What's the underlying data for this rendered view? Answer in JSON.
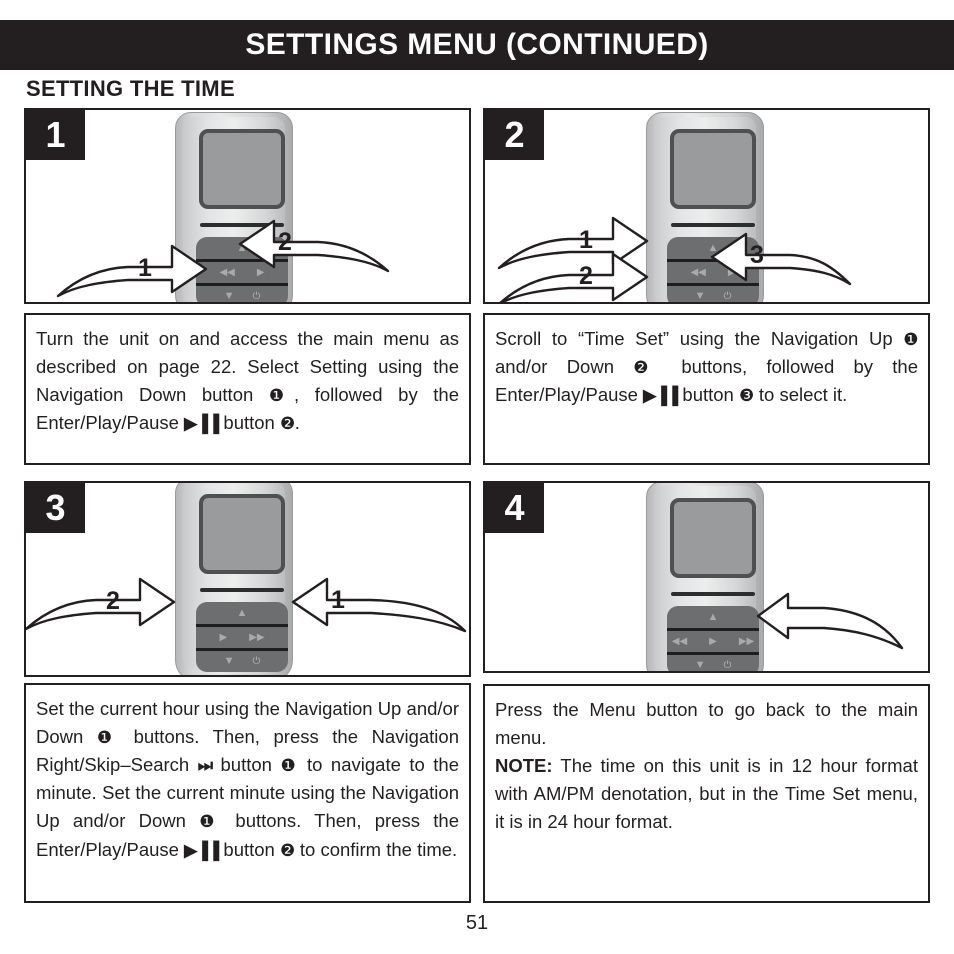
{
  "header": {
    "title": "SETTINGS MENU (CONTINUED)",
    "section_title": "SETTING THE TIME"
  },
  "colors": {
    "header_bg": "#231f20",
    "header_text": "#ffffff",
    "border": "#231f20",
    "device_body": "#d8d9da",
    "device_pad": "#6d6e70",
    "device_screen": "#9a9b9d"
  },
  "steps": [
    {
      "badge": "1",
      "callouts": [
        {
          "number": "1",
          "target": "navigation-down-button"
        },
        {
          "number": "2",
          "target": "enter-play-pause-button"
        }
      ],
      "text_parts": [
        {
          "t": "Turn the unit on and access the main menu as described on page 22. Select Setting using the Navigation Down button "
        },
        {
          "t": "❶",
          "style": "sym"
        },
        {
          "t": ", followed by the Enter/Play/Pause "
        },
        {
          "t": "▶▐▐",
          "style": "playpause"
        },
        {
          "t": " button "
        },
        {
          "t": "❷",
          "style": "sym"
        },
        {
          "t": "."
        }
      ]
    },
    {
      "badge": "2",
      "callouts": [
        {
          "number": "1",
          "target": "navigation-up-button"
        },
        {
          "number": "2",
          "target": "navigation-down-button"
        },
        {
          "number": "3",
          "target": "enter-play-pause-button"
        }
      ],
      "text_parts": [
        {
          "t": "Scroll to “Time Set” using the Navigation Up "
        },
        {
          "t": "❶",
          "style": "sym"
        },
        {
          "t": " and/or Down "
        },
        {
          "t": "❷",
          "style": "sym"
        },
        {
          "t": " buttons, followed by the Enter/Play/Pause "
        },
        {
          "t": "▶▐▐",
          "style": "playpause"
        },
        {
          "t": " button "
        },
        {
          "t": "❸",
          "style": "sym"
        },
        {
          "t": " to select it."
        }
      ]
    },
    {
      "badge": "3",
      "callouts": [
        {
          "number": "2",
          "target": "enter-play-pause-button"
        },
        {
          "number": "1",
          "target": "navigation-right-skip-search-button"
        }
      ],
      "text_parts": [
        {
          "t": "Set the current hour using the Navigation Up and/or Down "
        },
        {
          "t": "❶",
          "style": "sym"
        },
        {
          "t": " buttons. Then, press the Navigation Right/Skip–Search "
        },
        {
          "t": "⏭",
          "style": "playpause"
        },
        {
          "t": " button "
        },
        {
          "t": "❶",
          "style": "sym"
        },
        {
          "t": " to navigate to the minute. Set the current minute using the Navigation Up and/or Down "
        },
        {
          "t": "❶",
          "style": "sym"
        },
        {
          "t": " buttons. Then, press the Enter/Play/Pause "
        },
        {
          "t": "▶▐▐",
          "style": "playpause"
        },
        {
          "t": " button "
        },
        {
          "t": "❷",
          "style": "sym"
        },
        {
          "t": " to confirm the time."
        }
      ]
    },
    {
      "badge": "4",
      "callouts": [
        {
          "number": "",
          "target": "menu-button"
        }
      ],
      "text_parts": [
        {
          "t": "Press the Menu button to go back to the main menu."
        },
        {
          "t": "\n"
        },
        {
          "t": "NOTE:",
          "style": "bold"
        },
        {
          "t": " The time on this unit is in 12 hour format with AM/PM denotation, but in the Time Set menu, it is in 24 hour format."
        }
      ]
    }
  ],
  "device": {
    "glyphs": {
      "up": "▲",
      "down": "▼",
      "rewind": "◀◀",
      "play": "▶",
      "forward": "▶▶",
      "power": "⏻"
    }
  },
  "footer": {
    "page_number": "51"
  }
}
